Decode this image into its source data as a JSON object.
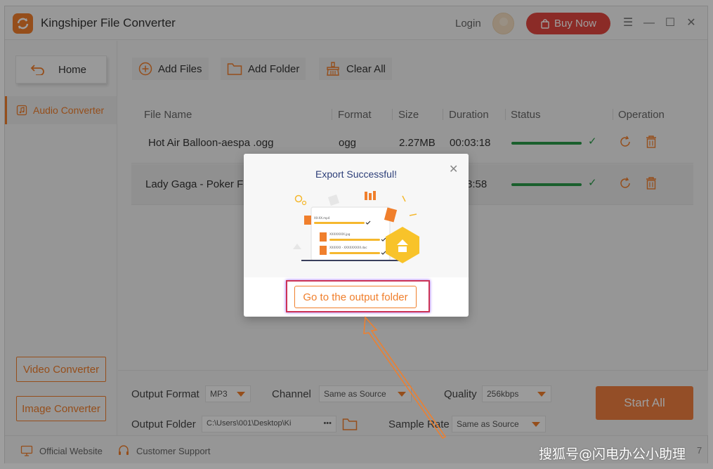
{
  "app": {
    "title": "Kingshiper File Converter",
    "login": "Login",
    "buy_now": "Buy Now"
  },
  "sidebar": {
    "home": "Home",
    "audio_converter": "Audio Converter",
    "video_converter": "Video Converter",
    "image_converter": "Image Converter"
  },
  "toolbar": {
    "add_files": "Add Files",
    "add_folder": "Add Folder",
    "clear_all": "Clear All"
  },
  "table": {
    "headers": [
      "File Name",
      "Format",
      "Size",
      "Duration",
      "Status",
      "Operation"
    ],
    "rows": [
      {
        "name": "Hot Air Balloon-aespa .ogg",
        "format": "ogg",
        "size": "2.27MB",
        "duration": "00:03:18",
        "progress": 1.0
      },
      {
        "name": "Lady Gaga - Poker Fa",
        "format": "",
        "size": "",
        "duration": "3:58",
        "progress": 1.0
      }
    ]
  },
  "settings": {
    "output_format_label": "Output Format",
    "output_format_value": "MP3",
    "channel_label": "Channel",
    "channel_value": "Same as Source",
    "quality_label": "Quality",
    "quality_value": "256kbps",
    "output_folder_label": "Output Folder",
    "output_folder_value": "C:\\Users\\001\\Desktop\\Ki",
    "folder_dots": "•••",
    "sample_rate_label": "Sample Rate",
    "sample_rate_value": "Same as Source",
    "start_all": "Start All"
  },
  "footer": {
    "official_website": "Official Website",
    "customer_support": "Customer Support",
    "page_num": "7"
  },
  "dialog": {
    "title": "Export Successful!",
    "button": "Go to the output folder",
    "illustration_files": [
      "XX-XX.mp4",
      "XXXXXXXX.jpg",
      "XXXXXX - XXXXXXXXX.doc"
    ]
  },
  "watermark": "搜狐号@闪电办公小助理",
  "colors": {
    "accent": "#f07f2c",
    "buy": "#e0463f",
    "success": "#2a9a4a",
    "dialog_title": "#2c3e78"
  }
}
